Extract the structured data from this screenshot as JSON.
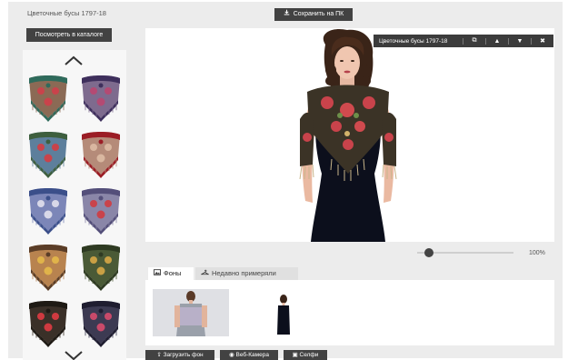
{
  "product": {
    "title": "Цветочные бусы 1797-18"
  },
  "catalog_button": "Посмотреть в каталоге",
  "save_button": "Сохранить на ПК",
  "toolbar": {
    "item_name": "Цветочные бусы 1797-18"
  },
  "zoom": {
    "value_label": "100%",
    "level": 0.08
  },
  "tabs": [
    {
      "label": "Фоны",
      "icon": "image-icon"
    },
    {
      "label": "Недавно примеряли",
      "icon": "hanger-icon"
    }
  ],
  "actions": {
    "upload": "Загрузить фон",
    "webcam": "Веб-Камера",
    "selfie": "Селфи"
  },
  "scarves": [
    {
      "base": "#8b6a55",
      "accent": "#2f6b5c",
      "flower": "#c9434b"
    },
    {
      "base": "#7e6b8e",
      "accent": "#3e2f5c",
      "flower": "#b44a73"
    },
    {
      "base": "#5d7f9c",
      "accent": "#3e5f3e",
      "flower": "#c9434b"
    },
    {
      "base": "#b58b79",
      "accent": "#9b1d25",
      "flower": "#d9b7a0"
    },
    {
      "base": "#7c86b8",
      "accent": "#3b4f8a",
      "flower": "#d8d8e8"
    },
    {
      "base": "#8a86a8",
      "accent": "#544f7a",
      "flower": "#c9434b"
    },
    {
      "base": "#b8834f",
      "accent": "#5a3d27",
      "flower": "#e0b34a"
    },
    {
      "base": "#4a5a36",
      "accent": "#2e3a22",
      "flower": "#c9a044"
    },
    {
      "base": "#3a3028",
      "accent": "#1e1a14",
      "flower": "#cf3a40"
    },
    {
      "base": "#3c3a52",
      "accent": "#1f1d30",
      "flower": "#c94a6a"
    }
  ]
}
